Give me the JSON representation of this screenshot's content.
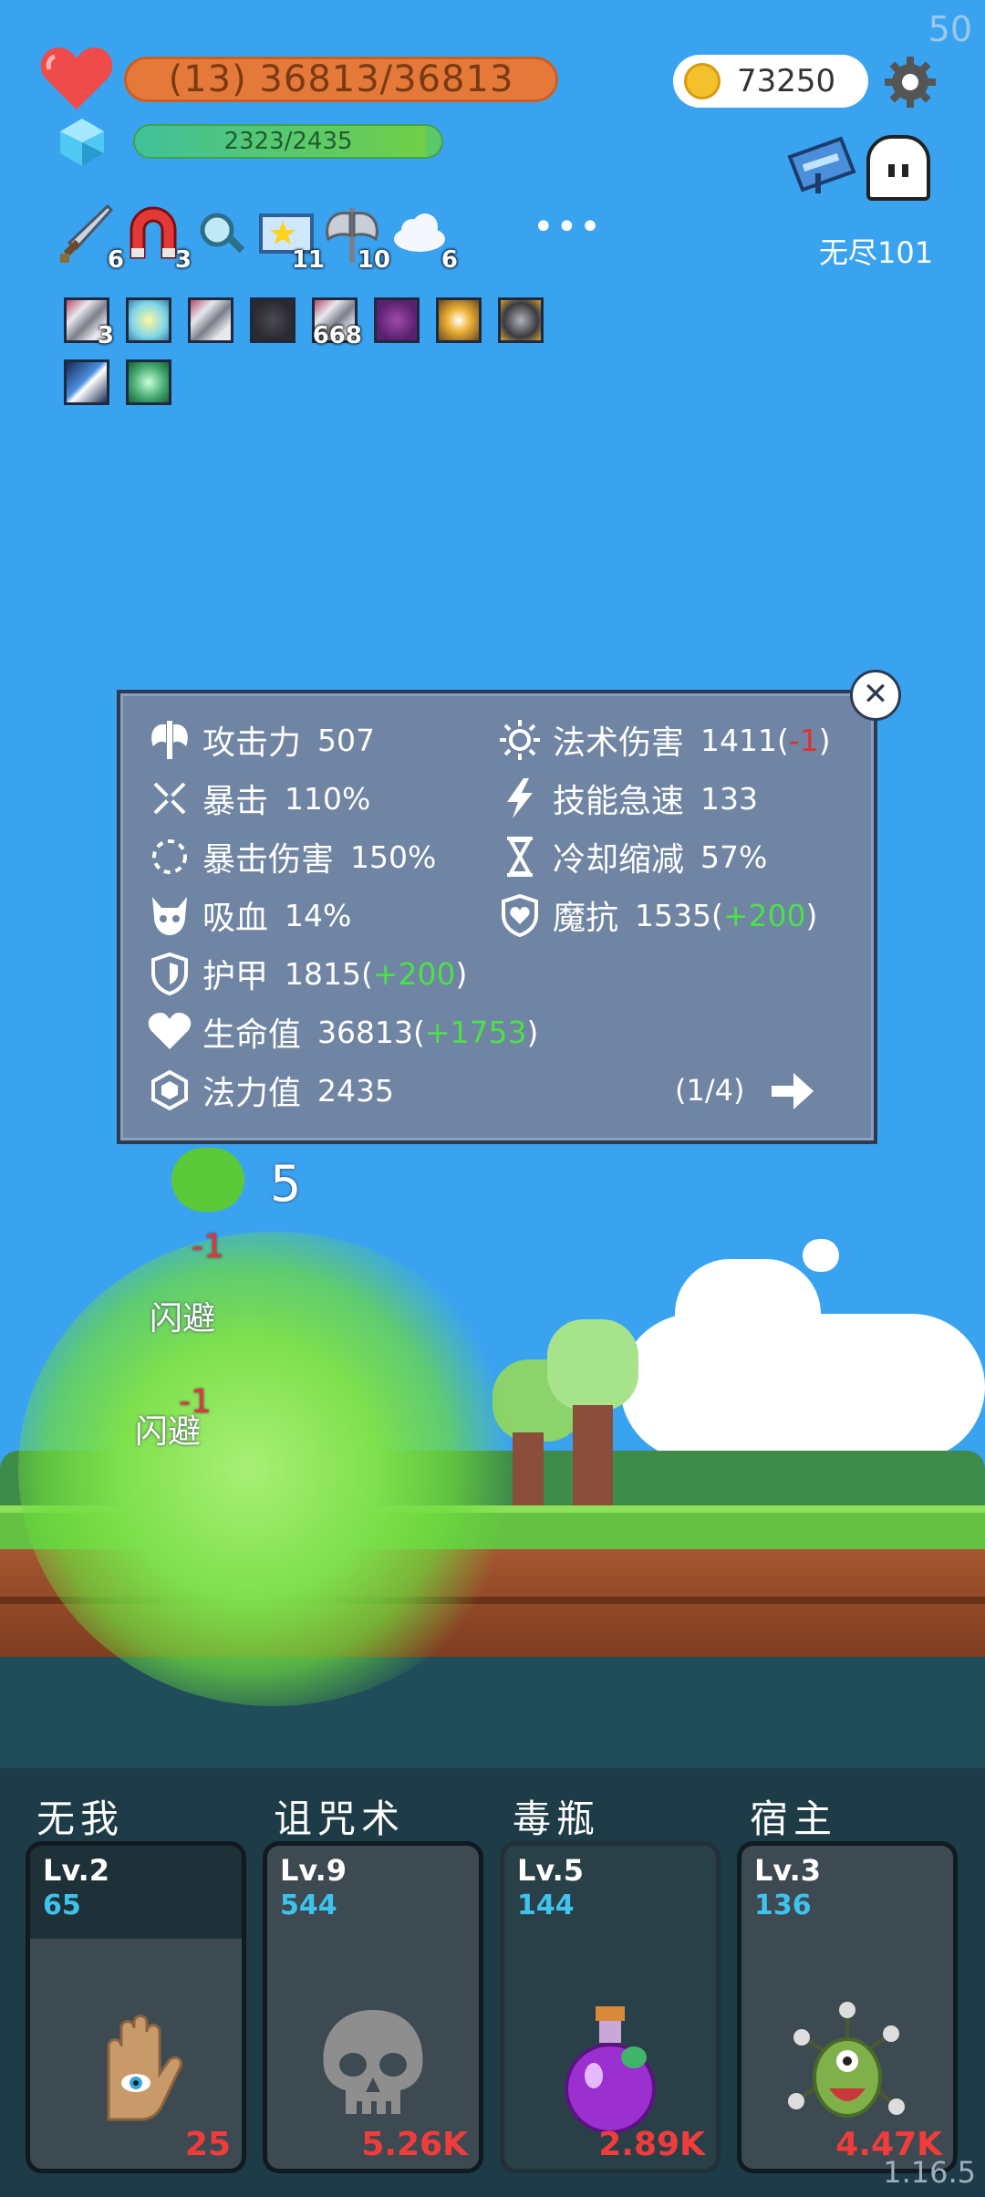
{
  "hud": {
    "hp_text": "(13) 36813/36813",
    "mp_text": "2323/2435",
    "coins": "73250",
    "endless_label": "无尽101",
    "fps": "50",
    "version": "1.16.5"
  },
  "buffs": [
    {
      "icon": "sword-icon",
      "count": "6"
    },
    {
      "icon": "magnet-icon",
      "count": "3"
    },
    {
      "icon": "magnifier-icon",
      "count": ""
    },
    {
      "icon": "star-card-icon",
      "count": "11"
    },
    {
      "icon": "double-axe-icon",
      "count": "10"
    },
    {
      "icon": "cloud-icon",
      "count": "6"
    }
  ],
  "more_label": "•••",
  "items": [
    {
      "icon": "striped-scroll-icon",
      "count": "3"
    },
    {
      "icon": "lightbulb-icon",
      "count": ""
    },
    {
      "icon": "striped-scroll-icon",
      "count": ""
    },
    {
      "icon": "dark-armor-icon",
      "count": ""
    },
    {
      "icon": "striped-scroll-icon",
      "count": "668"
    },
    {
      "icon": "purple-demon-icon",
      "count": ""
    },
    {
      "icon": "gold-shield-icon",
      "count": ""
    },
    {
      "icon": "dark-shield-icon",
      "count": ""
    },
    {
      "icon": "blue-flame-icon",
      "count": ""
    },
    {
      "icon": "green-rune-icon",
      "count": ""
    }
  ],
  "stats_panel": {
    "left": [
      {
        "icon": "axe-icon",
        "label": "攻击力",
        "value": "507",
        "delta": ""
      },
      {
        "icon": "crit-icon",
        "label": "暴击",
        "value": "110%",
        "delta": ""
      },
      {
        "icon": "crit-damage-icon",
        "label": "暴击伤害",
        "value": "150%",
        "delta": ""
      },
      {
        "icon": "lifesteal-icon",
        "label": "吸血",
        "value": "14%",
        "delta": ""
      },
      {
        "icon": "armor-icon",
        "label": "护甲",
        "value": "1815",
        "delta": "+200"
      },
      {
        "icon": "heart-icon",
        "label": "生命值",
        "value": "36813",
        "delta": "+1753"
      },
      {
        "icon": "mana-icon",
        "label": "法力值",
        "value": "2435",
        "delta": ""
      }
    ],
    "right": [
      {
        "icon": "sun-icon",
        "label": "法术伤害",
        "value": "1411",
        "delta": "-1"
      },
      {
        "icon": "lightning-icon",
        "label": "技能急速",
        "value": "133",
        "delta": ""
      },
      {
        "icon": "hourglass-icon",
        "label": "冷却缩减",
        "value": "57%",
        "delta": ""
      },
      {
        "icon": "magic-resist-icon",
        "label": "魔抗",
        "value": "1535",
        "delta": "+200"
      }
    ],
    "page": "(1/4)",
    "close_label": "✕"
  },
  "combat_text": {
    "number": "5",
    "dodge1": "闪避",
    "dodge2": "闪避",
    "minus": "-1"
  },
  "skills": [
    {
      "name": "无我",
      "level": "Lv.2",
      "cost": "65",
      "damage": "25",
      "icon": "eye-hand-icon"
    },
    {
      "name": "诅咒术",
      "level": "Lv.9",
      "cost": "544",
      "damage": "5.26K",
      "icon": "skull-icon"
    },
    {
      "name": "毒瓶",
      "level": "Lv.5",
      "cost": "144",
      "damage": "2.89K",
      "icon": "poison-flask-icon"
    },
    {
      "name": "宿主",
      "level": "Lv.3",
      "cost": "136",
      "damage": "4.47K",
      "icon": "eyeball-monster-icon"
    }
  ]
}
